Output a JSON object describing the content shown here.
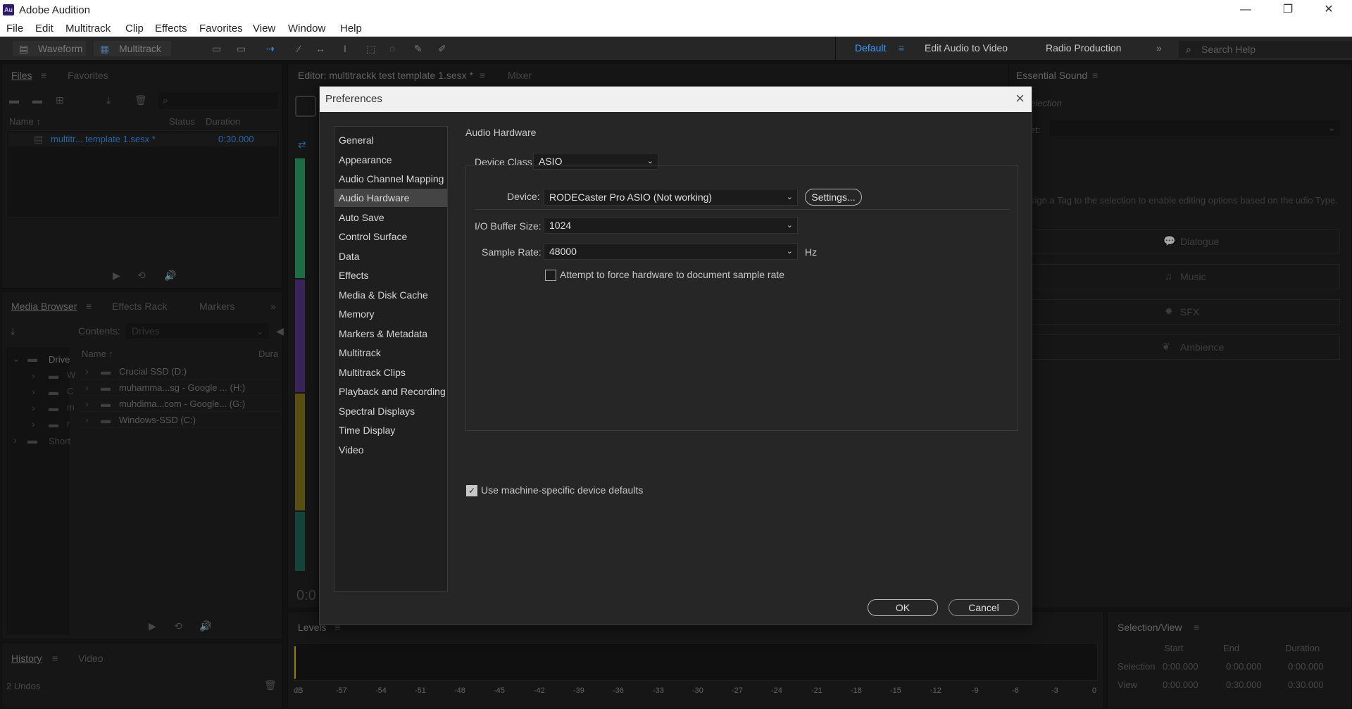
{
  "window": {
    "app_logo": "Au",
    "title": "Adobe Audition",
    "minimize": "—",
    "maximize": "❐",
    "close": "✕"
  },
  "menu": [
    "File",
    "Edit",
    "Multitrack",
    "Clip",
    "Effects",
    "Favorites",
    "View",
    "Window",
    "Help"
  ],
  "toolbar": {
    "waveform": "Waveform",
    "multitrack": "Multitrack",
    "workspaces": [
      "Default",
      "Edit Audio to Video",
      "Radio Production"
    ],
    "search_placeholder": "Search Help"
  },
  "files_panel": {
    "tabs": [
      "Files",
      "Favorites"
    ],
    "columns": [
      "Name ↑",
      "Status",
      "Duration"
    ],
    "item_name": "multitr... template 1.sesx *",
    "item_duration": "0:30.000"
  },
  "media_browser": {
    "tabs": [
      "Media Browser",
      "Effects Rack",
      "Markers"
    ],
    "contents_label": "Contents:",
    "contents_value": "Drives",
    "tree": [
      "Drive",
      "W",
      "C",
      "m",
      "r",
      "Short"
    ],
    "columns": [
      "Name ↑",
      "Dura"
    ],
    "drives": [
      "Crucial SSD (D:)",
      "muhamma...sg - Google ... (H:)",
      "muhdima...com - Google... (G:)",
      "Windows-SSD (C:)"
    ]
  },
  "history": {
    "tabs": [
      "History",
      "Video"
    ],
    "status": "2 Undos"
  },
  "editor": {
    "tab": "Editor: multitrackk test template 1.sesx *",
    "mixer": "Mixer",
    "time": "0:0"
  },
  "essential_sound": {
    "title": "Essential Sound",
    "selection": "election",
    "preset_label": "et:",
    "hint": "sign a Tag to the selection to enable editing options based on the udio Type.",
    "types": [
      "Dialogue",
      "Music",
      "SFX",
      "Ambience"
    ]
  },
  "levels": {
    "title": "Levels",
    "ticks": [
      "dB",
      "-57",
      "-54",
      "-51",
      "-48",
      "-45",
      "-42",
      "-39",
      "-36",
      "-33",
      "-30",
      "-27",
      "-24",
      "-21",
      "-18",
      "-15",
      "-12",
      "-9",
      "-6",
      "-3",
      "0"
    ]
  },
  "selection_view": {
    "title": "Selection/View",
    "headers": [
      "Start",
      "End",
      "Duration"
    ],
    "rows": [
      {
        "label": "Selection",
        "start": "0:00.000",
        "end": "0:00.000",
        "duration": "0:00.000"
      },
      {
        "label": "View",
        "start": "0:00.000",
        "end": "0:30.000",
        "duration": "0:30.000"
      }
    ]
  },
  "dialog": {
    "title": "Preferences",
    "nav": [
      "General",
      "Appearance",
      "Audio Channel Mapping",
      "Audio Hardware",
      "Auto Save",
      "Control Surface",
      "Data",
      "Effects",
      "Media & Disk Cache",
      "Memory",
      "Markers & Metadata",
      "Multitrack",
      "Multitrack Clips",
      "Playback and Recording",
      "Spectral Displays",
      "Time Display",
      "Video"
    ],
    "selected_nav": "Audio Hardware",
    "section_title": "Audio Hardware",
    "device_class_label": "Device Class:",
    "device_class_value": "ASIO",
    "device_label": "Device:",
    "device_value": "RODECaster Pro ASIO (Not working)",
    "settings_button": "Settings...",
    "buffer_label": "I/O Buffer Size:",
    "buffer_value": "1024",
    "sample_rate_label": "Sample Rate:",
    "sample_rate_value": "48000",
    "hz": "Hz",
    "force_rate_label": "Attempt to force hardware to document sample rate",
    "force_rate_checked": false,
    "machine_defaults_label": "Use machine-specific device defaults",
    "machine_defaults_checked": true,
    "ok": "OK",
    "cancel": "Cancel"
  }
}
